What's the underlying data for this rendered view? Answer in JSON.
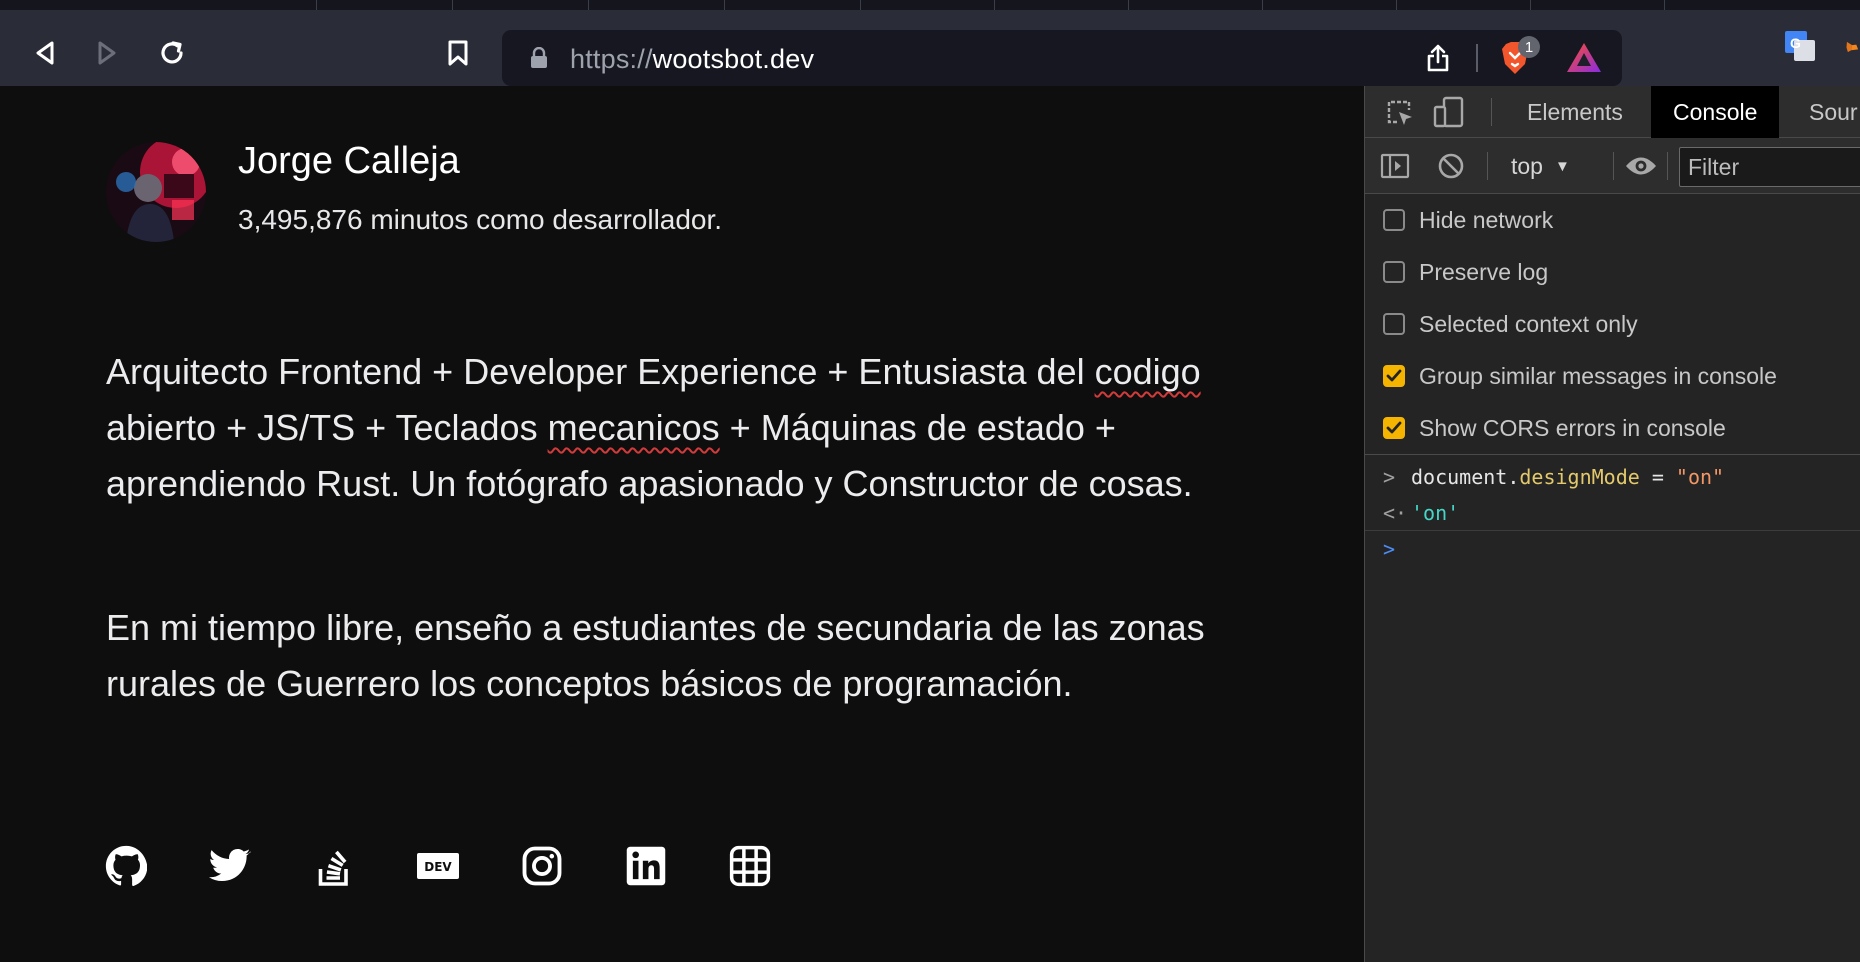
{
  "browser": {
    "url_scheme": "https://",
    "url_host": "wootsbot.dev",
    "shield_count": "1"
  },
  "profile": {
    "name": "Jorge Calleja",
    "subtitle": "3,495,876 minutos como desarrollador."
  },
  "bio": {
    "p1_parts": [
      "Arquitecto Frontend + Developer Experience + Entusiasta del ",
      "codigo",
      " abierto + JS/TS + Teclados ",
      "mecanicos",
      " + Máquinas de estado + aprendiendo Rust. Un fotógrafo apasionado y Constructor de cosas."
    ],
    "p2": "En mi tiempo libre, enseño a estudiantes de secundaria de las zonas rurales de Guerrero los conceptos básicos de programación."
  },
  "social": [
    "github-icon",
    "twitter-icon",
    "stackoverflow-icon",
    "devto-icon",
    "instagram-icon",
    "linkedin-icon",
    "polywork-icon"
  ],
  "devtools": {
    "tabs": [
      "Elements",
      "Console",
      "Sour"
    ],
    "active_tab": "Console",
    "context": "top",
    "filter_placeholder": "Filter",
    "options": [
      {
        "label": "Hide network",
        "checked": false
      },
      {
        "label": "Preserve log",
        "checked": false
      },
      {
        "label": "Selected context only",
        "checked": false
      },
      {
        "label": "Group similar messages in console",
        "checked": true
      },
      {
        "label": "Show CORS errors in console",
        "checked": true
      }
    ],
    "console": {
      "input_obj": "document.",
      "input_prop": "designMode",
      "input_op": " = ",
      "input_str": "\"on\"",
      "result": "'on'"
    }
  },
  "colors": {
    "page_bg": "#0e0e0f",
    "chrome_bg": "#2a2c38",
    "devtools_bg": "#242424",
    "checkbox_accent": "#f4b400",
    "spellcheck": "#d33b3b"
  }
}
